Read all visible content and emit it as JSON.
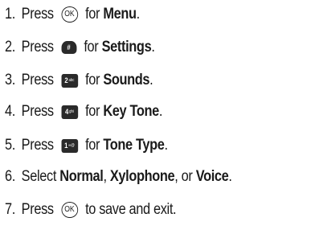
{
  "steps": [
    {
      "num": "1.",
      "pre": "Press ",
      "key": {
        "icon": "ok-key-icon",
        "glyph": "OK"
      },
      "post": " for ",
      "bold": "Menu",
      "end": "."
    },
    {
      "num": "2.",
      "pre": "Press ",
      "key": {
        "icon": "pound-key-icon",
        "glyph": "#"
      },
      "post": " for ",
      "bold": "Settings",
      "end": "."
    },
    {
      "num": "3.",
      "pre": "Press ",
      "key": {
        "icon": "key-2-icon",
        "glyph": "2"
      },
      "post": " for ",
      "bold": "Sounds",
      "end": "."
    },
    {
      "num": "4.",
      "pre": "Press ",
      "key": {
        "icon": "key-4-icon",
        "glyph": "4"
      },
      "post": " for ",
      "bold": "Key Tone",
      "end": "."
    },
    {
      "num": "5.",
      "pre": "Press ",
      "key": {
        "icon": "key-1-icon",
        "glyph": "1"
      },
      "post": " for ",
      "bold": "Tone Type",
      "end": "."
    },
    {
      "num": "6.",
      "pre": "Select ",
      "opt1": "Normal",
      "sep1": ", ",
      "opt2": "Xylophone",
      "sep2": ", or ",
      "opt3": "Voice",
      "end": "."
    },
    {
      "num": "7.",
      "pre": "Press ",
      "key": {
        "icon": "ok-key-icon",
        "glyph": "OK"
      },
      "post": " to save and exit."
    }
  ]
}
